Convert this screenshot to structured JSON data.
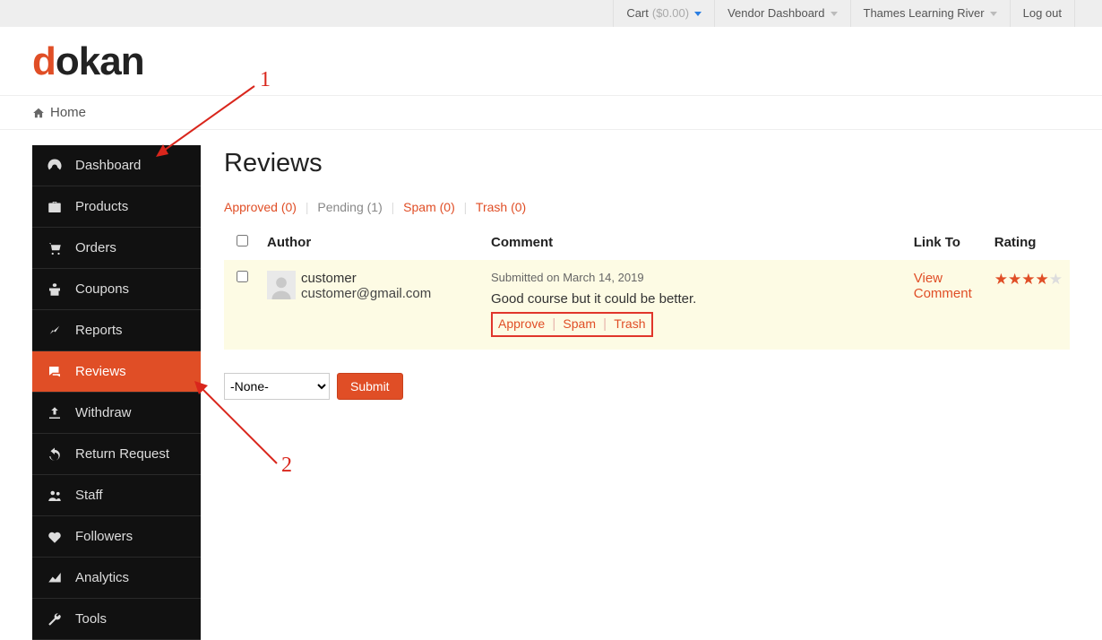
{
  "topbar": {
    "cart_label": "Cart",
    "cart_amount": "($0.00)",
    "vendor_dashboard": "Vendor Dashboard",
    "user_name": "Thames Learning River",
    "logout": "Log out"
  },
  "logo": {
    "first": "d",
    "rest": "okan"
  },
  "breadcrumb": {
    "home": "Home"
  },
  "sidebar": {
    "items": [
      {
        "label": "Dashboard",
        "icon": "dashboard"
      },
      {
        "label": "Products",
        "icon": "briefcase"
      },
      {
        "label": "Orders",
        "icon": "cart"
      },
      {
        "label": "Coupons",
        "icon": "gift"
      },
      {
        "label": "Reports",
        "icon": "chart"
      },
      {
        "label": "Reviews",
        "icon": "comments",
        "active": true
      },
      {
        "label": "Withdraw",
        "icon": "upload"
      },
      {
        "label": "Return Request",
        "icon": "undo"
      },
      {
        "label": "Staff",
        "icon": "users"
      },
      {
        "label": "Followers",
        "icon": "heart"
      },
      {
        "label": "Analytics",
        "icon": "area"
      },
      {
        "label": "Tools",
        "icon": "wrench"
      }
    ]
  },
  "page": {
    "title": "Reviews"
  },
  "tabs": {
    "approved": "Approved (0)",
    "pending": "Pending (1)",
    "spam": "Spam (0)",
    "trash": "Trash (0)"
  },
  "table": {
    "headers": {
      "author": "Author",
      "comment": "Comment",
      "linkto": "Link To",
      "rating": "Rating"
    },
    "rows": [
      {
        "author_name": "customer",
        "author_email": "customer@gmail.com",
        "submitted": "Submitted on March 14, 2019",
        "comment": "Good course but it could be better.",
        "actions": {
          "approve": "Approve",
          "spam": "Spam",
          "trash": "Trash"
        },
        "link_label": "View Comment",
        "rating": 4,
        "rating_max": 5
      }
    ]
  },
  "bulk": {
    "none_option": "-None-",
    "submit": "Submit"
  },
  "annotations": {
    "one": "1",
    "two": "2"
  }
}
